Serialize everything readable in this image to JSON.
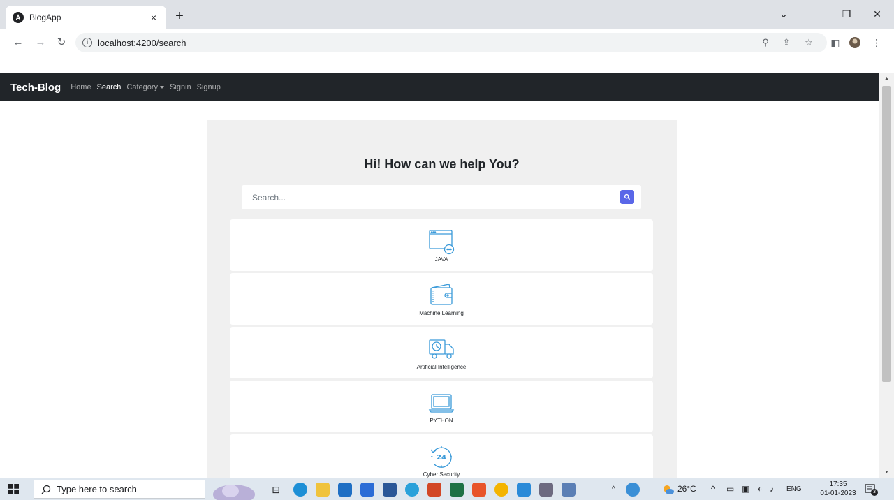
{
  "browser": {
    "tab_title": "BlogApp",
    "tab_close": "×",
    "new_tab": "+",
    "url": "localhost:4200/search",
    "win_minimize": "–",
    "win_restore": "❐",
    "win_close": "✕",
    "win_down": "⌄"
  },
  "nav": {
    "brand": "Tech-Blog",
    "links": [
      {
        "label": "Home",
        "active": false
      },
      {
        "label": "Search",
        "active": true
      },
      {
        "label": "Category",
        "active": false,
        "dropdown": true
      },
      {
        "label": "Signin",
        "active": false
      },
      {
        "label": "Signup",
        "active": false
      }
    ]
  },
  "page": {
    "heading": "Hi! How can we help You?",
    "search_placeholder": "Search...",
    "search_value": ""
  },
  "categories": [
    {
      "label": "JAVA",
      "icon": "browser-window-chat-icon"
    },
    {
      "label": "Machine Learning",
      "icon": "wallet-icon"
    },
    {
      "label": "Artificial Intelligence",
      "icon": "delivery-truck-clock-icon"
    },
    {
      "label": "PYTHON",
      "icon": "laptop-icon"
    },
    {
      "label": "Cyber Security",
      "icon": "clock-24-icon"
    }
  ],
  "taskbar": {
    "search_placeholder": "Type here to search",
    "weather": "26°C",
    "language": "ENG",
    "time": "17:35",
    "date": "01-01-2023",
    "notifications": "3"
  },
  "colors": {
    "navbar": "#212529",
    "accent": "#5a67e8",
    "icon_stroke": "#3a9ad9",
    "panel": "#f0f0f0"
  }
}
